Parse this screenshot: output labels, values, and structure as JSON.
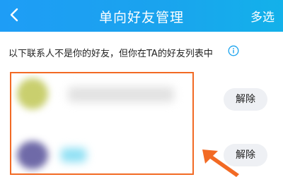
{
  "header": {
    "back_icon": "chevron-left-icon",
    "title": "单向好友管理",
    "multi_select_label": "多选",
    "bg_color": "#1e9df6"
  },
  "notice": {
    "text": "以下联系人不是你的好友，但你在TA的好友列表中",
    "info_icon": "info-circle-icon",
    "accent_color": "#1aa3ee"
  },
  "contacts": [
    {
      "remove_label": "解除"
    },
    {
      "remove_label": "解除"
    }
  ],
  "annotation": {
    "box_color": "#f26a24"
  }
}
